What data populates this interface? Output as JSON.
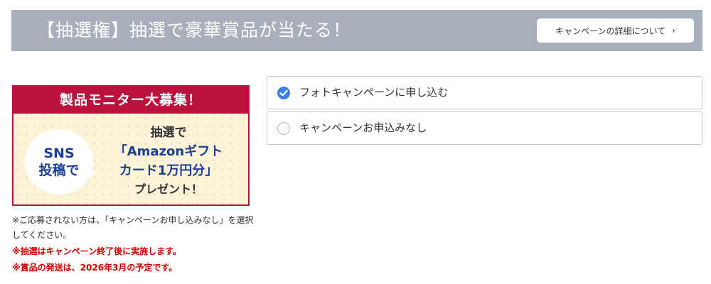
{
  "header": {
    "title": "【抽選権】抽選で豪華賞品が当たる！",
    "details_button": "キャンペーンの詳細について",
    "details_chevron": "›"
  },
  "banner": {
    "head": "製品モニター大募集！",
    "bubble_line1": "SNS",
    "bubble_line2": "投稿で",
    "line1": "抽選で",
    "line2": "「Amazonギフト",
    "line3": "カード1万円分」",
    "line4": "プレゼント！",
    "colors": {
      "accent": "#b8123d",
      "text_blue": "#1d3f94",
      "bg": "#fdf3d8"
    }
  },
  "notes": {
    "note1": "※ご応募されない方は、「キャンペーンお申し込みなし」を選択してください。",
    "note2": "※抽選はキャンペーン終了後に実施します。",
    "note3": "※賞品の発送は、2026年3月の予定です。"
  },
  "options": [
    {
      "label": "フォトキャンペーンに申し込む",
      "checked": true
    },
    {
      "label": "キャンペーンお申込みなし",
      "checked": false
    }
  ],
  "colors": {
    "header_bg": "#a9afba",
    "radio_checked": "#3d7ff0",
    "note_red": "#d40000"
  }
}
